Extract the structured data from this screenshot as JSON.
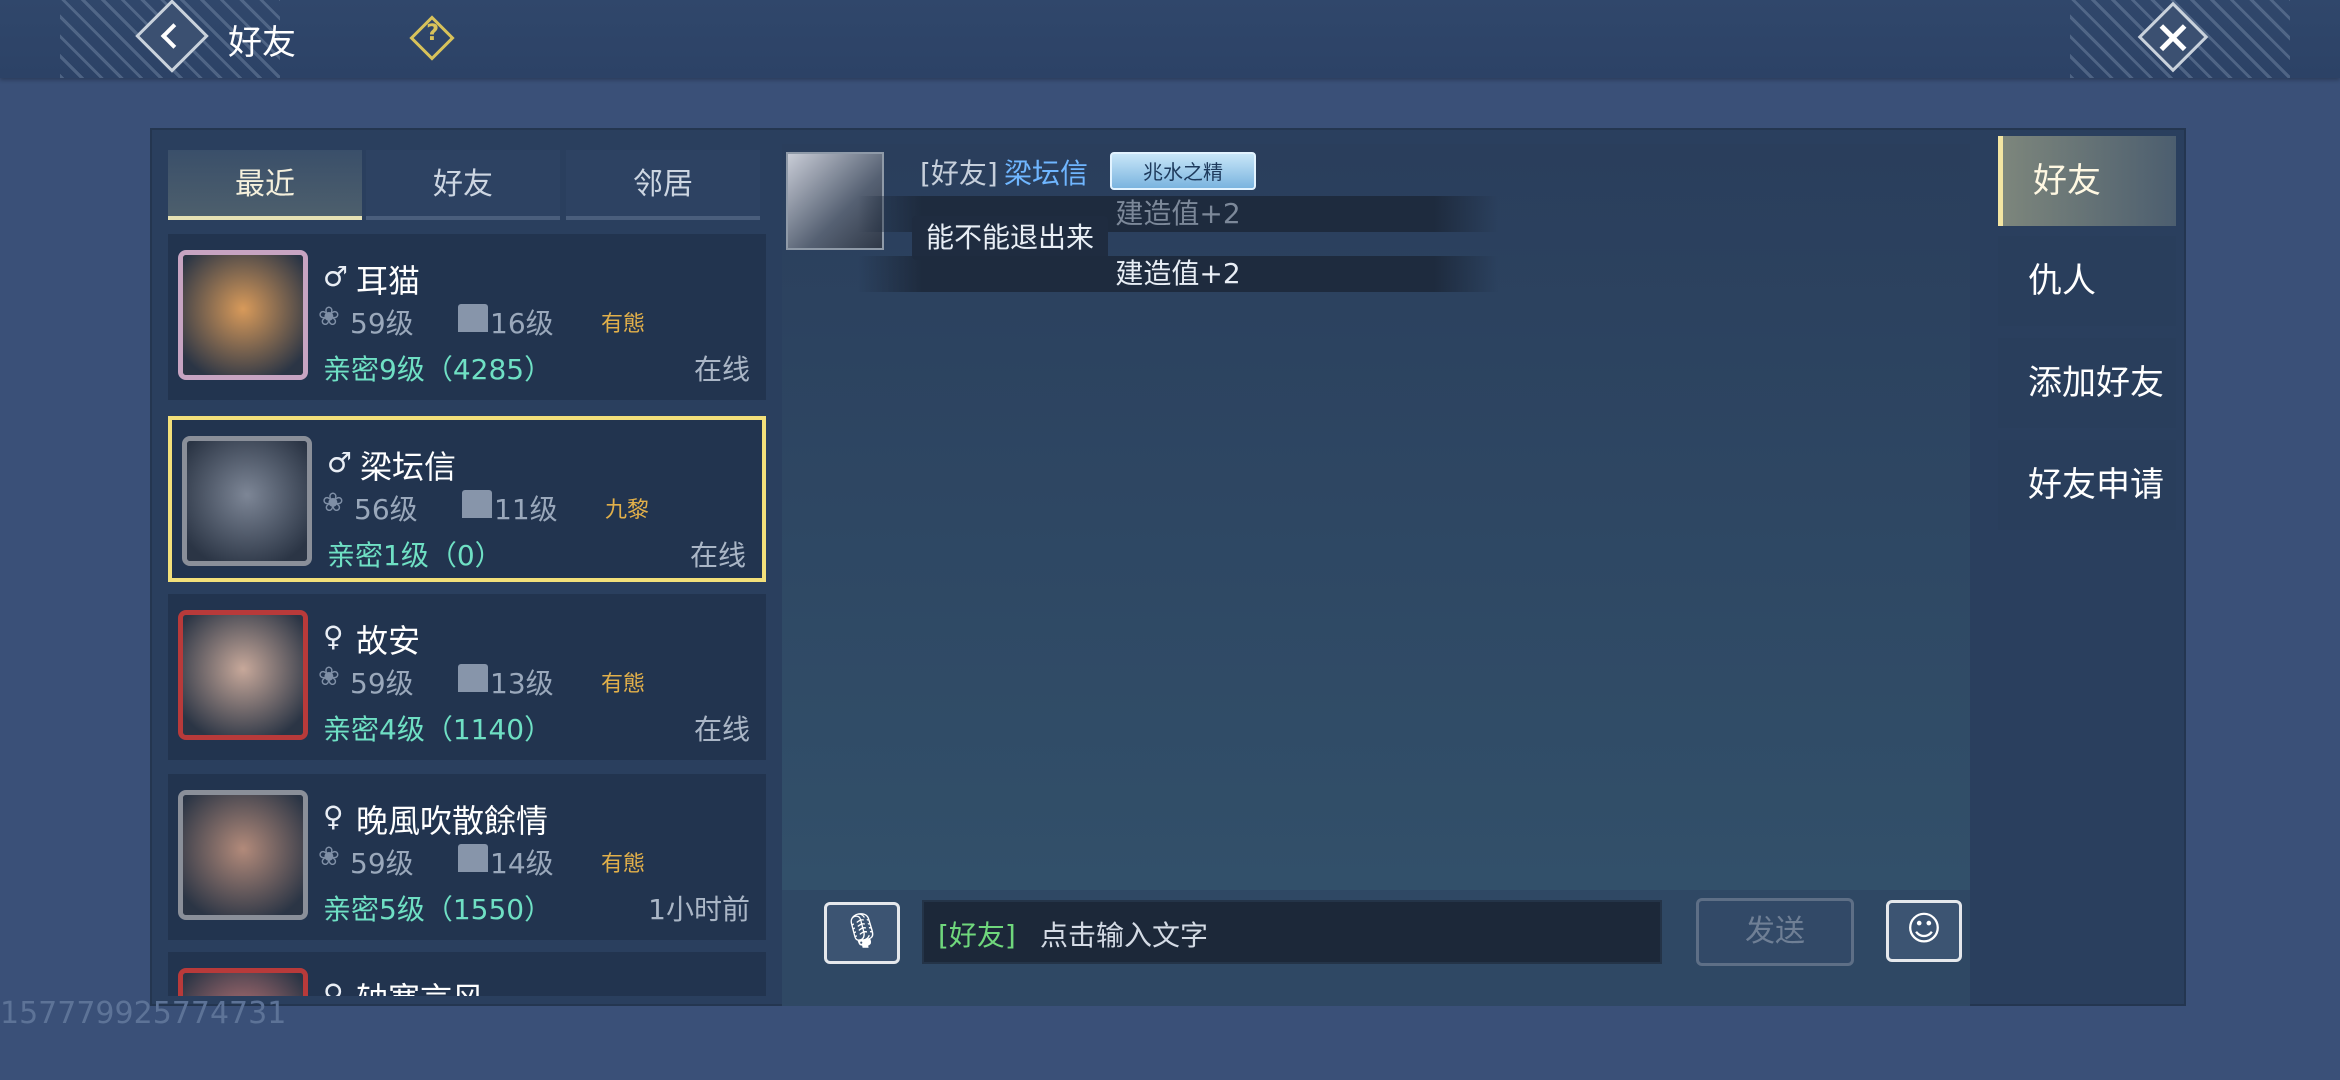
{
  "header": {
    "title": "好友",
    "back_icon": "back-arrow-icon",
    "help_icon": "question-icon",
    "close_icon": "close-x-icon"
  },
  "tabs": [
    {
      "label": "最近",
      "active": true
    },
    {
      "label": "好友",
      "active": false
    },
    {
      "label": "邻居",
      "active": false
    }
  ],
  "friends": [
    {
      "gender": "♂",
      "name": "耳猫",
      "level": "59级",
      "house": "16级",
      "guild": "有態",
      "intimacy": "亲密9级（4285）",
      "status": "在线",
      "selected": false,
      "avatar_color": "#d89a5a"
    },
    {
      "gender": "♂",
      "name": "梁坛信",
      "level": "56级",
      "house": "11级",
      "guild": "九黎",
      "intimacy": "亲密1级（0）",
      "status": "在线",
      "selected": true,
      "avatar_color": "#7d8696"
    },
    {
      "gender": "♀",
      "name": "故安",
      "level": "59级",
      "house": "13级",
      "guild": "有態",
      "intimacy": "亲密4级（1140）",
      "status": "在线",
      "selected": false,
      "avatar_color": "#c7a89a"
    },
    {
      "gender": "♀",
      "name": "晚風吹散餘情",
      "level": "59级",
      "house": "14级",
      "guild": "有態",
      "intimacy": "亲密5级（1550）",
      "status": "1小时前",
      "selected": false,
      "avatar_color": "#b28a7a"
    },
    {
      "gender": "♀",
      "name": "轴塞言风",
      "level": "",
      "house": "",
      "guild": "",
      "intimacy": "",
      "status": "",
      "selected": false,
      "avatar_color": "#c97a7a"
    }
  ],
  "chat": {
    "channel": "[好友]",
    "sender": "梁坛信",
    "title_badge": "兆水之精",
    "message": "能不能退出来",
    "system_lines": [
      "建造值+2",
      "建造值+2"
    ]
  },
  "input": {
    "channel": "[好友]",
    "placeholder": "点击输入文字",
    "send_label": "发送",
    "voice_icon": "microphone-icon",
    "emoji_icon": "emoji-icon"
  },
  "side_tabs": [
    {
      "label": "好友",
      "active": true
    },
    {
      "label": "仇人",
      "active": false
    },
    {
      "label": "添加好友",
      "active": false
    },
    {
      "label": "好友申请",
      "active": false
    }
  ],
  "watermark": "157779925774731"
}
